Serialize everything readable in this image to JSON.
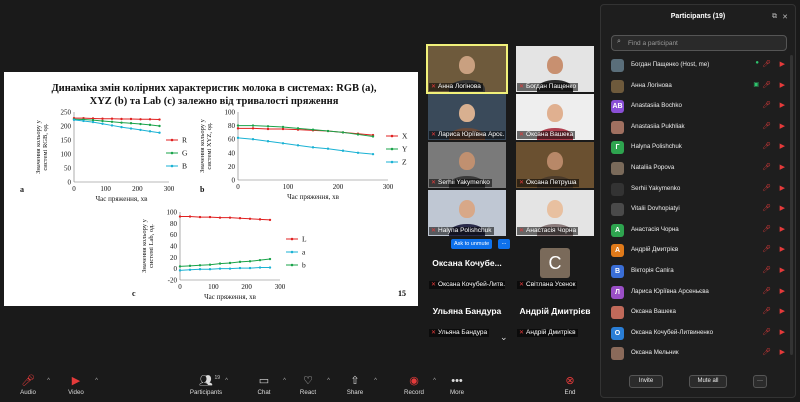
{
  "slide": {
    "title": "Динаміка змін колірних характеристик молока в системах: RGB (a), XYZ (b) та Lab (c) залежно від тривалості пряження",
    "page_number": "15"
  },
  "chart_data": [
    {
      "type": "line",
      "panel_label": "a",
      "xlabel": "Час пряження, хв",
      "ylabel": "Значення кольору у системі RGB, од.",
      "xlim": [
        0,
        300
      ],
      "ylim": [
        0,
        250
      ],
      "xticks": [
        0,
        100,
        200,
        300
      ],
      "yticks": [
        0,
        50,
        100,
        150,
        200,
        250
      ],
      "x": [
        0,
        30,
        60,
        90,
        120,
        150,
        180,
        210,
        240,
        270
      ],
      "series": [
        {
          "name": "R",
          "color": "#e02020",
          "values": [
            228,
            228,
            227,
            226,
            226,
            225,
            225,
            224,
            224,
            223
          ]
        },
        {
          "name": "G",
          "color": "#1aa34a",
          "values": [
            224,
            223,
            221,
            218,
            215,
            212,
            210,
            207,
            204,
            200
          ]
        },
        {
          "name": "B",
          "color": "#1ab2d4",
          "values": [
            222,
            218,
            214,
            208,
            202,
            196,
            191,
            186,
            181,
            176
          ]
        }
      ]
    },
    {
      "type": "line",
      "panel_label": "b",
      "xlabel": "Час пряження, хв",
      "ylabel": "Значення кольору у системі XYZ, од.",
      "xlim": [
        0,
        300
      ],
      "ylim": [
        0,
        100
      ],
      "xticks": [
        0,
        100,
        200,
        300
      ],
      "yticks": [
        0,
        20,
        40,
        60,
        80,
        100
      ],
      "x": [
        0,
        30,
        60,
        90,
        120,
        150,
        180,
        210,
        240,
        270
      ],
      "series": [
        {
          "name": "X",
          "color": "#e02020",
          "values": [
            76,
            76,
            75,
            75,
            74,
            73,
            72,
            70,
            68,
            66
          ]
        },
        {
          "name": "Y",
          "color": "#1aa34a",
          "values": [
            80,
            80,
            79,
            78,
            76,
            74,
            72,
            70,
            67,
            64
          ]
        },
        {
          "name": "Z",
          "color": "#1ab2d4",
          "values": [
            62,
            60,
            57,
            54,
            51,
            48,
            46,
            43,
            40,
            38
          ]
        }
      ]
    },
    {
      "type": "line",
      "panel_label": "c",
      "xlabel": "Час пряження, хв",
      "ylabel": "Значення кольору у системі Lab, од.",
      "xlim": [
        0,
        300
      ],
      "ylim": [
        -20,
        100
      ],
      "xticks": [
        0,
        100,
        200,
        300
      ],
      "yticks": [
        -20,
        0,
        20,
        40,
        60,
        80,
        100
      ],
      "x": [
        0,
        30,
        60,
        90,
        120,
        150,
        180,
        210,
        240,
        270
      ],
      "series": [
        {
          "name": "L",
          "color": "#e02020",
          "values": [
            92,
            92,
            91,
            91,
            90,
            90,
            89,
            88,
            87,
            86
          ]
        },
        {
          "name": "a",
          "color": "#1ab2d4",
          "values": [
            -3,
            -2,
            -1,
            -1,
            0,
            0,
            1,
            1,
            2,
            2
          ]
        },
        {
          "name": "b",
          "color": "#1aa34a",
          "values": [
            4,
            5,
            6,
            7,
            9,
            10,
            12,
            13,
            15,
            17
          ]
        }
      ]
    }
  ],
  "video_grid": {
    "tiles": [
      {
        "name": "Анна Логінова",
        "muted": true,
        "active": true,
        "skin": "#c9a080",
        "bg": "#6e5a3c",
        "shirt": "#333"
      },
      {
        "name": "Богдан Пащенко",
        "muted": true,
        "active": false,
        "skin": "#c89070",
        "bg": "#e4e4e4",
        "shirt": "#2a2a2a"
      },
      {
        "name": "Лариса Юрїївна Арсє...",
        "muted": true,
        "active": false,
        "skin": "#d8b090",
        "bg": "#3a4a5a",
        "shirt": "#6a4a3a"
      },
      {
        "name": "Оксана Вашека",
        "muted": true,
        "active": false,
        "skin": "#e0b090",
        "bg": "#eeeeee",
        "shirt": "#b04050"
      },
      {
        "name": "Serhii Yakymenko",
        "muted": true,
        "active": false,
        "skin": "#c09070",
        "bg": "#7a7a7a",
        "shirt": "#3a3a3a"
      },
      {
        "name": "Оксана Петруша",
        "muted": true,
        "active": false,
        "skin": "#b88868",
        "bg": "#6a5030",
        "shirt": "#4a3a2a"
      },
      {
        "name": "Halyna Polishchuk",
        "muted": true,
        "active": false,
        "skin": "#d8a888",
        "bg": "#bfc7d3",
        "shirt": "#2a2a4a"
      },
      {
        "name": "Анастасія Чорна",
        "muted": true,
        "active": false,
        "skin": "#e8c0a0",
        "bg": "#e4e4e4",
        "shirt": "#8a7a7a"
      }
    ],
    "ask_to_unmute": "Ask to unmute",
    "ask_more": "...",
    "name_only_tiles": [
      {
        "big": "Оксана Кочубе...",
        "label": "Оксана Кочубей-Литв..."
      },
      {
        "big": "С",
        "label": "Світлана Усенок",
        "avatar": true
      },
      {
        "big": "Ульяна Бандура",
        "label": "Ульяна Бандура"
      },
      {
        "big": "Андрій Дмитрієв",
        "label": "Андрій Дмитрієв"
      }
    ]
  },
  "participants_panel": {
    "title": "Participants (19)",
    "search_placeholder": "Find a participant",
    "invite_label": "Invite",
    "mute_all_label": "Mute all",
    "more_label": "···",
    "list": [
      {
        "name": "Богдан Пащенко (Host, me)",
        "avatar_color": "#5a6e7a",
        "initial": "",
        "extra": "●"
      },
      {
        "name": "Анна Логінова",
        "avatar_color": "#6e5a3c",
        "initial": "",
        "extra": "▣"
      },
      {
        "name": "Anastasiia Bochko",
        "avatar_color": "#8a4fd6",
        "initial": "AB",
        "extra": ""
      },
      {
        "name": "Anastasiia Pukhliak",
        "avatar_color": "#a07060",
        "initial": "",
        "extra": ""
      },
      {
        "name": "Halyna Polishchuk",
        "avatar_color": "#2ea44f",
        "initial": "Г",
        "extra": ""
      },
      {
        "name": "Nataliia Popova",
        "avatar_color": "#7a6a5a",
        "initial": "",
        "extra": ""
      },
      {
        "name": "Serhii Yakymenko",
        "avatar_color": "#333333",
        "initial": "",
        "extra": ""
      },
      {
        "name": "Vitalii Dovhopiatyi",
        "avatar_color": "#4a4a4a",
        "initial": "",
        "extra": ""
      },
      {
        "name": "Анастасія Чорна",
        "avatar_color": "#2ea44f",
        "initial": "A",
        "extra": ""
      },
      {
        "name": "Андрій Дмитрієв",
        "avatar_color": "#e07a1a",
        "initial": "A",
        "extra": ""
      },
      {
        "name": "Вікторія Сапіга",
        "avatar_color": "#3a6ed6",
        "initial": "В",
        "extra": ""
      },
      {
        "name": "Лариса Юріївна Арсеньєва",
        "avatar_color": "#9a4fc6",
        "initial": "Л",
        "extra": ""
      },
      {
        "name": "Оксана Вашека",
        "avatar_color": "#c06a5a",
        "initial": "",
        "extra": ""
      },
      {
        "name": "Оксана Кочубей-Литвиненко",
        "avatar_color": "#2a7ed6",
        "initial": "О",
        "extra": ""
      },
      {
        "name": "Оксана Мельник",
        "avatar_color": "#8a6a5a",
        "initial": "",
        "extra": ""
      }
    ]
  },
  "toolbar": {
    "audio": "Audio",
    "video": "Video",
    "participants": "Participants",
    "participants_count": "19",
    "chat": "Chat",
    "react": "React",
    "share": "Share",
    "record": "Record",
    "more": "More",
    "end": "End"
  },
  "colors": {
    "zoom_blue": "#0e71eb",
    "muted_red": "#e43a3a",
    "active_speaker": "#f1f17a"
  }
}
